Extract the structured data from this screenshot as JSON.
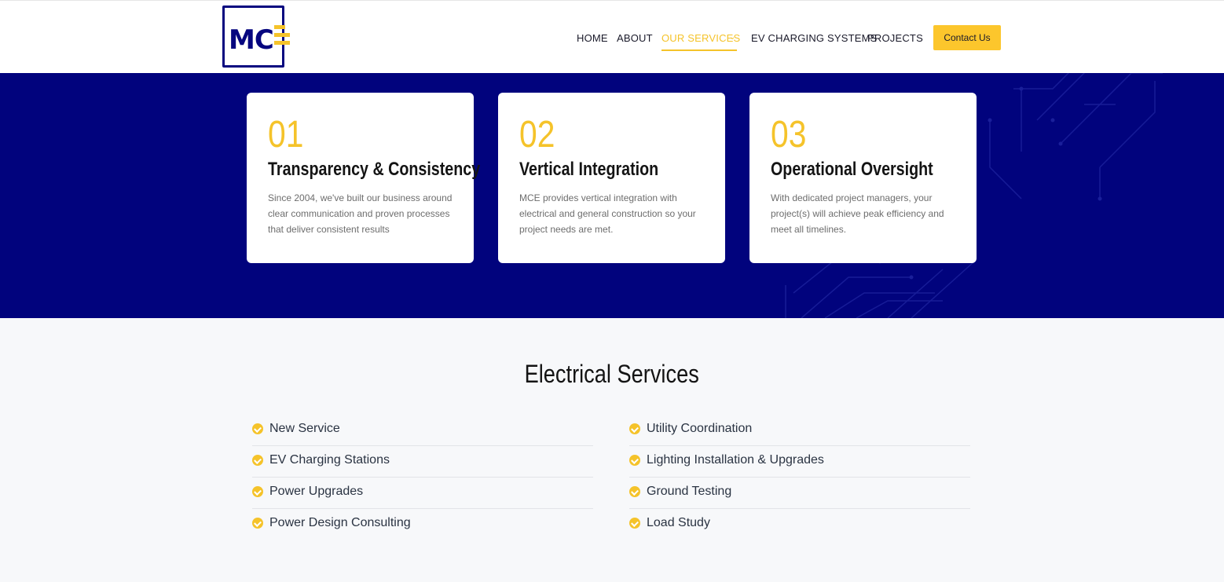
{
  "brand": {
    "logo_text": "MC",
    "accent": "#f5c32a",
    "navy": "#01037d"
  },
  "nav": {
    "items": [
      {
        "label": "HOME"
      },
      {
        "label": "ABOUT"
      },
      {
        "label": "OUR SERVICES"
      },
      {
        "label": "EV CHARGING SYSTEMS"
      },
      {
        "label": "PROJECTS"
      }
    ],
    "active": "OUR SERVICES",
    "contact_label": "Contact Us"
  },
  "cards": [
    {
      "num": "01",
      "title": "Transparency & Consistency",
      "desc": "Since 2004, we've built our business around clear communication and proven processes that deliver consistent results"
    },
    {
      "num": "02",
      "title": "Vertical Integration",
      "desc": "MCE provides vertical integration with electrical and general construction so your project needs are met."
    },
    {
      "num": "03",
      "title": "Operational Oversight",
      "desc": "With dedicated project managers, your project(s) will achieve peak efficiency and meet all timelines."
    }
  ],
  "services": {
    "title": "Electrical Services",
    "left": [
      "New Service",
      "EV Charging Stations",
      "Power Upgrades",
      "Power Design Consulting"
    ],
    "right": [
      "Utility Coordination",
      "Lighting Installation & Upgrades",
      "Ground Testing",
      "Load Study"
    ]
  }
}
